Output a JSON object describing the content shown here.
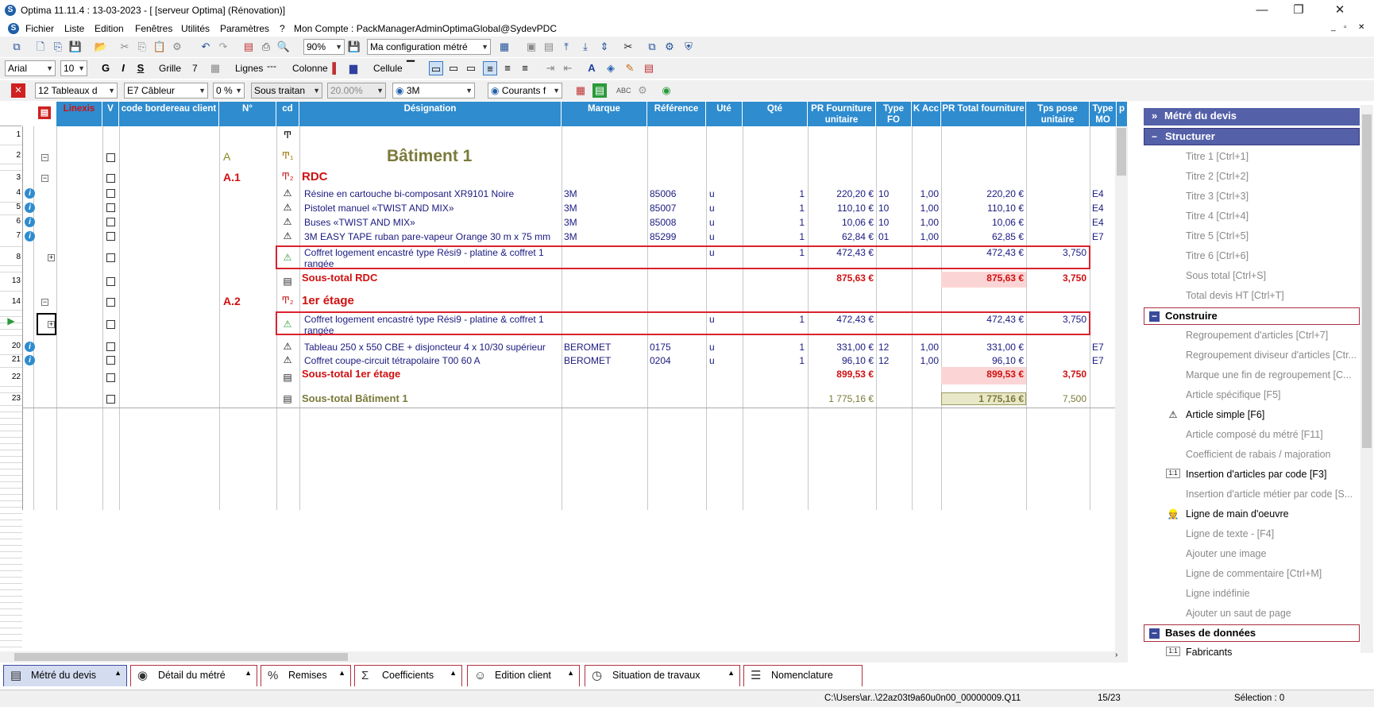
{
  "window": {
    "title": "Optima 11.11.4 : 13-03-2023 - [ [serveur Optima] (Rénovation)]",
    "minimize": "—",
    "restore": "❐",
    "close": "✕"
  },
  "menu": [
    "Fichier",
    "Liste",
    "Edition",
    "Fenêtres",
    "Utilités",
    "Paramètres",
    "?",
    "Mon Compte : PackManagerAdminOptimaGlobal@SydevPDC"
  ],
  "toolbar1": {
    "zoom": "90%",
    "config": "Ma configuration métré"
  },
  "toolbar2": {
    "font": "Arial",
    "size": "10",
    "bold": "G",
    "italic": "I",
    "strike": "S",
    "grille": "Grille",
    "grille_val": "7",
    "lignes": "Lignes",
    "colonne": "Colonne",
    "cellule": "Cellule"
  },
  "toolbar3": {
    "tableaux": "12  Tableaux d",
    "cableur": "E7  Câbleur",
    "zero": "0 %",
    "soustraitan": "Sous traitan",
    "percent": "20.00%",
    "supplier": "3M",
    "courants": "Courants f"
  },
  "columns": [
    "Linexis",
    "V",
    "code bordereau client",
    "N°",
    "cd",
    "Désignation",
    "Marque",
    "Référence",
    "Uté",
    "Qté",
    "PR Fourniture unitaire",
    "Type FO",
    "K Acc",
    "PR Total fourniture",
    "Tps pose unitaire",
    "Type MO",
    "p"
  ],
  "rows": [
    {
      "n": "1",
      "num": "",
      "des": "",
      "type": "text"
    },
    {
      "n": "2",
      "num": "A",
      "des": "Bâtiment 1",
      "type": "t1"
    },
    {
      "n": "3",
      "num": "A.1",
      "des": "RDC",
      "type": "t2"
    },
    {
      "n": "4",
      "des": "Résine en cartouche bi-composant XR9101 Noire",
      "marque": "3M",
      "ref": "85006",
      "ute": "u",
      "qte": "1",
      "pru": "220,20 €",
      "tfo": "10",
      "kacc": "1,00",
      "prt": "220,20 €",
      "tps": "",
      "tmo": "E4"
    },
    {
      "n": "5",
      "des": "Pistolet manuel «TWIST AND MIX»",
      "marque": "3M",
      "ref": "85007",
      "ute": "u",
      "qte": "1",
      "pru": "110,10 €",
      "tfo": "10",
      "kacc": "1,00",
      "prt": "110,10 €",
      "tps": "",
      "tmo": "E4"
    },
    {
      "n": "6",
      "des": "Buses «TWIST AND MIX»",
      "marque": "3M",
      "ref": "85008",
      "ute": "u",
      "qte": "1",
      "pru": "10,06 €",
      "tfo": "10",
      "kacc": "1,00",
      "prt": "10,06 €",
      "tps": "",
      "tmo": "E4"
    },
    {
      "n": "7",
      "des": "3M EASY TAPE ruban pare-vapeur Orange 30 m x 75 mm",
      "marque": "3M",
      "ref": "85299",
      "ute": "u",
      "qte": "1",
      "pru": "62,84 €",
      "tfo": "01",
      "kacc": "1,00",
      "prt": "62,85 €",
      "tps": "",
      "tmo": "E7"
    },
    {
      "n": "8",
      "des1": "Coffret logement encastré type Rési9 - platine & coffret 1",
      "des2": "rangée",
      "ute": "u",
      "qte": "1",
      "pru": "472,43 €",
      "prt": "472,43 €",
      "tps": "3,750"
    },
    {
      "n": "13",
      "des": "Sous-total RDC",
      "pru": "875,63 €",
      "prt": "875,63 €",
      "tps": "3,750"
    },
    {
      "n": "14",
      "num": "A.2",
      "des": "1er étage"
    },
    {
      "n": "",
      "des1": "Coffret logement encastré type Rési9 - platine & coffret 1",
      "des2": "rangée",
      "ute": "u",
      "qte": "1",
      "pru": "472,43 €",
      "prt": "472,43 €",
      "tps": "3,750"
    },
    {
      "n": "20",
      "des": "Tableau 250 x 550 CBE + disjoncteur 4 x 10/30 supérieur",
      "marque": "BEROMET",
      "ref": "0175",
      "ute": "u",
      "qte": "1",
      "pru": "331,00 €",
      "tfo": "12",
      "kacc": "1,00",
      "prt": "331,00 €",
      "tps": "",
      "tmo": "E7"
    },
    {
      "n": "21",
      "des": "Coffret coupe-circuit tétrapolaire T00 60 A",
      "marque": "BEROMET",
      "ref": "0204",
      "ute": "u",
      "qte": "1",
      "pru": "96,10 €",
      "tfo": "12",
      "kacc": "1,00",
      "prt": "96,10 €",
      "tps": "",
      "tmo": "E7"
    },
    {
      "n": "22",
      "des": "Sous-total 1er étage",
      "pru": "899,53 €",
      "prt": "899,53 €",
      "tps": "3,750"
    },
    {
      "n": "23",
      "des": "Sous-total Bâtiment 1",
      "pru": "1 775,16 €",
      "prt": "1 775,16 €",
      "tps": "7,500"
    }
  ],
  "panel": {
    "header": "Métré du devis",
    "structurer": "Structurer",
    "structurer_items": [
      "Titre 1 [Ctrl+1]",
      "Titre 2 [Ctrl+2]",
      "Titre 3 [Ctrl+3]",
      "Titre 4 [Ctrl+4]",
      "Titre 5 [Ctrl+5]",
      "Titre 6 [Ctrl+6]",
      "Sous total [Ctrl+S]",
      "Total devis HT [Ctrl+T]"
    ],
    "construire": "Construire",
    "construire_items": [
      "Regroupement d'articles  [Ctrl+7]",
      "Regroupement diviseur d'articles [Ctr...",
      "Marque une fin de regroupement    [C...",
      "Article spécifique [F5]",
      "Article simple [F6]",
      "Article composé du métré [F11]",
      "Coefficient de rabais / majoration",
      "Insertion d'articles par code [F3]",
      "Insertion d'article métier par code [S...",
      "Ligne de main d'oeuvre",
      "Ligne de texte - [F4]",
      "Ajouter une image",
      "Ligne de commentaire [Ctrl+M]",
      "Ligne indéfinie",
      "Ajouter un saut de page"
    ],
    "bases": "Bases de données",
    "bases_items": [
      "Fabricants"
    ]
  },
  "tabs": [
    "Métré du devis",
    "Détail du métré",
    "Remises",
    "Coefficients",
    "Edition client",
    "Situation de travaux",
    "Nomenclature"
  ],
  "status": {
    "path": "C:\\Users\\ar..\\22az03t9a60u0n00_00000009.Q11",
    "pos": "15/23",
    "selection": "Sélection : 0"
  }
}
